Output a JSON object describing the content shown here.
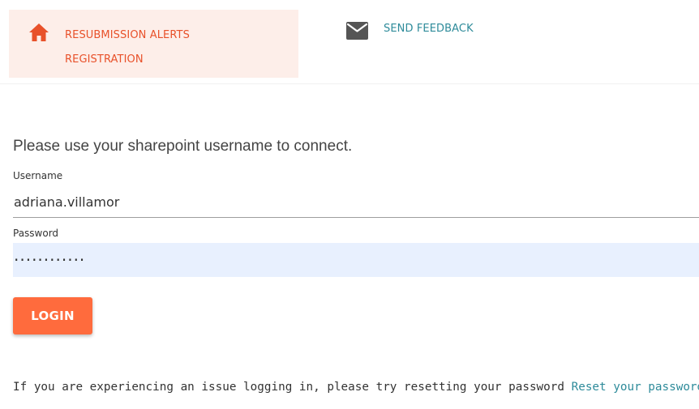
{
  "nav": {
    "home": {
      "icon": "home-icon",
      "label": "RESUBMISSION ALERTS\nREGISTRATION",
      "color": "#e8512a",
      "background": "#fdeee9"
    },
    "feedback": {
      "icon": "mail-icon",
      "label": "SEND FEEDBACK",
      "color": "#2e8b9a"
    }
  },
  "form": {
    "intro": "Please use your sharepoint username to connect.",
    "username": {
      "label": "Username",
      "value": "adriana.villamor"
    },
    "password": {
      "label": "Password",
      "value": "············"
    },
    "login_label": "LOGIN",
    "accent_color": "#ff6b3d"
  },
  "help": {
    "text": "If you are experiencing an issue logging in, please try resetting your password",
    "link": "Reset your password"
  }
}
